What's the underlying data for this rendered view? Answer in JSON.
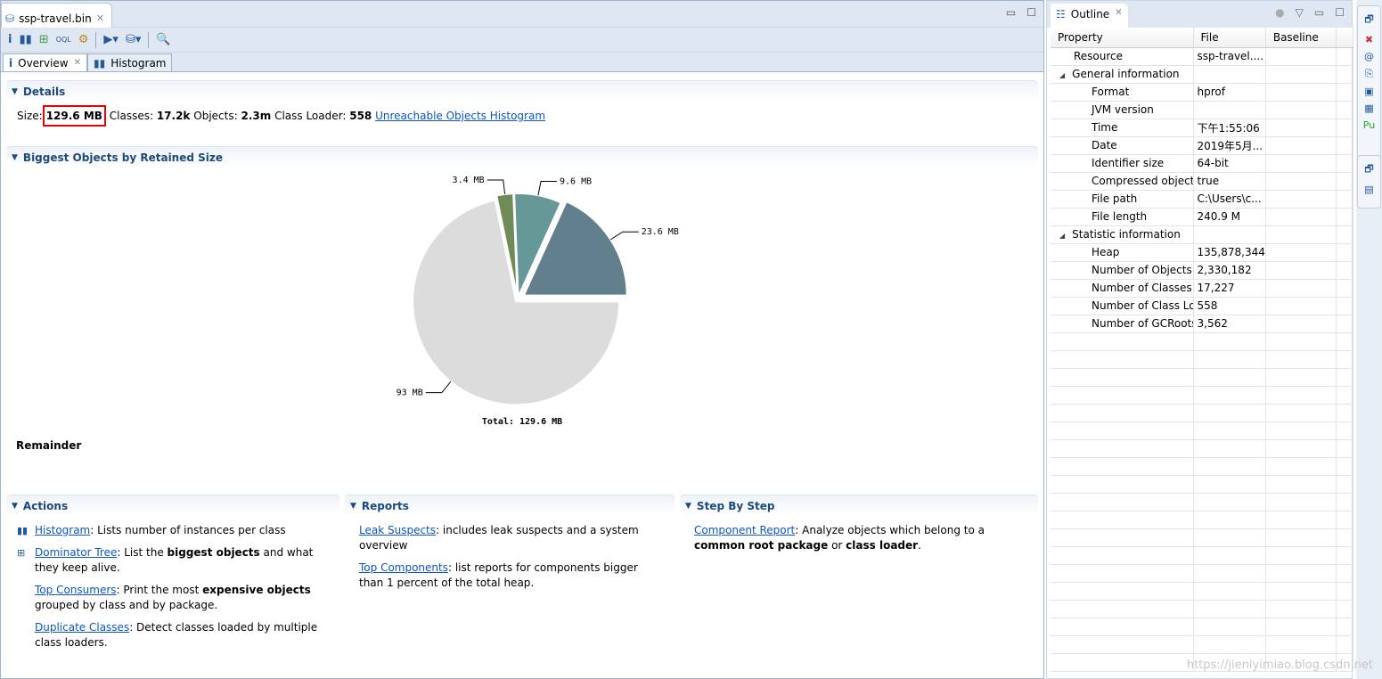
{
  "editor": {
    "tab_title": "ssp-travel.bin",
    "subtabs": [
      {
        "label": "Overview"
      },
      {
        "label": "Histogram"
      }
    ]
  },
  "details": {
    "title": "Details",
    "size_label": "Size:",
    "size": "129.6 MB",
    "classes_label": "Classes:",
    "classes": "17.2k",
    "objects_label": "Objects:",
    "objects": "2.3m",
    "loader_label": "Class Loader:",
    "loader": "558",
    "link": "Unreachable Objects Histogram"
  },
  "biggest": {
    "title": "Biggest Objects by Retained Size",
    "remainder": "Remainder"
  },
  "chart_data": {
    "type": "pie",
    "unit": "MB",
    "slices": [
      {
        "label": "23.6 MB",
        "value": 23.6,
        "color": "#627f8e"
      },
      {
        "label": "9.6 MB",
        "value": 9.6,
        "color": "#659896"
      },
      {
        "label": "3.4 MB",
        "value": 3.4,
        "color": "#6f8b58"
      },
      {
        "label": "93 MB",
        "value": 93,
        "color": "#dcdcdc"
      }
    ],
    "total_label": "Total: 129.6 MB"
  },
  "actions": {
    "title": "Actions",
    "items": [
      {
        "link": "Histogram",
        "parts": [
          ": Lists number of instances per class"
        ]
      },
      {
        "link": "Dominator Tree",
        "parts": [
          ": List the ",
          "biggest objects",
          " and what they keep alive."
        ]
      },
      {
        "link": "Top Consumers",
        "parts": [
          ": Print the most ",
          "expensive objects",
          " grouped by class and by package."
        ]
      },
      {
        "link": "Duplicate Classes",
        "parts": [
          ": Detect classes loaded by multiple class loaders."
        ]
      }
    ]
  },
  "reports": {
    "title": "Reports",
    "items": [
      {
        "link": "Leak Suspects",
        "parts": [
          ": includes leak suspects and a system overview"
        ]
      },
      {
        "link": "Top Components",
        "parts": [
          ": list reports for components bigger than 1 percent of the total heap."
        ]
      }
    ]
  },
  "step": {
    "title": "Step By Step",
    "items": [
      {
        "link": "Component Report",
        "parts": [
          ": Analyze objects which belong to a ",
          "common root package",
          " or ",
          "class loader",
          "."
        ]
      }
    ]
  },
  "outline": {
    "title": "Outline",
    "columns": [
      "Property",
      "File",
      "Baseline"
    ],
    "rows": [
      {
        "level": 1,
        "property": "Resource",
        "file": "ssp-travel...."
      },
      {
        "level": 0,
        "group": true,
        "property": "General information",
        "file": ""
      },
      {
        "level": 2,
        "property": "Format",
        "file": "hprof"
      },
      {
        "level": 2,
        "property": "JVM version",
        "file": ""
      },
      {
        "level": 2,
        "property": "Time",
        "file": "下午1:55:06"
      },
      {
        "level": 2,
        "property": "Date",
        "file": "2019年5月..."
      },
      {
        "level": 2,
        "property": "Identifier size",
        "file": "64-bit"
      },
      {
        "level": 2,
        "property": "Compressed object",
        "file": "true"
      },
      {
        "level": 2,
        "property": "File path",
        "file": "C:\\Users\\c..."
      },
      {
        "level": 2,
        "property": "File length",
        "file": "240.9 M"
      },
      {
        "level": 0,
        "group": true,
        "property": "Statistic information",
        "file": ""
      },
      {
        "level": 2,
        "property": "Heap",
        "file": "135,878,344"
      },
      {
        "level": 2,
        "property": "Number of Objects",
        "file": "2,330,182"
      },
      {
        "level": 2,
        "property": "Number of Classes",
        "file": "17,227"
      },
      {
        "level": 2,
        "property": "Number of Class Lo",
        "file": "558"
      },
      {
        "level": 2,
        "property": "Number of GCRoots",
        "file": "3,562"
      }
    ]
  },
  "watermark": "https://jieniyimiao.blog.csdn.net"
}
